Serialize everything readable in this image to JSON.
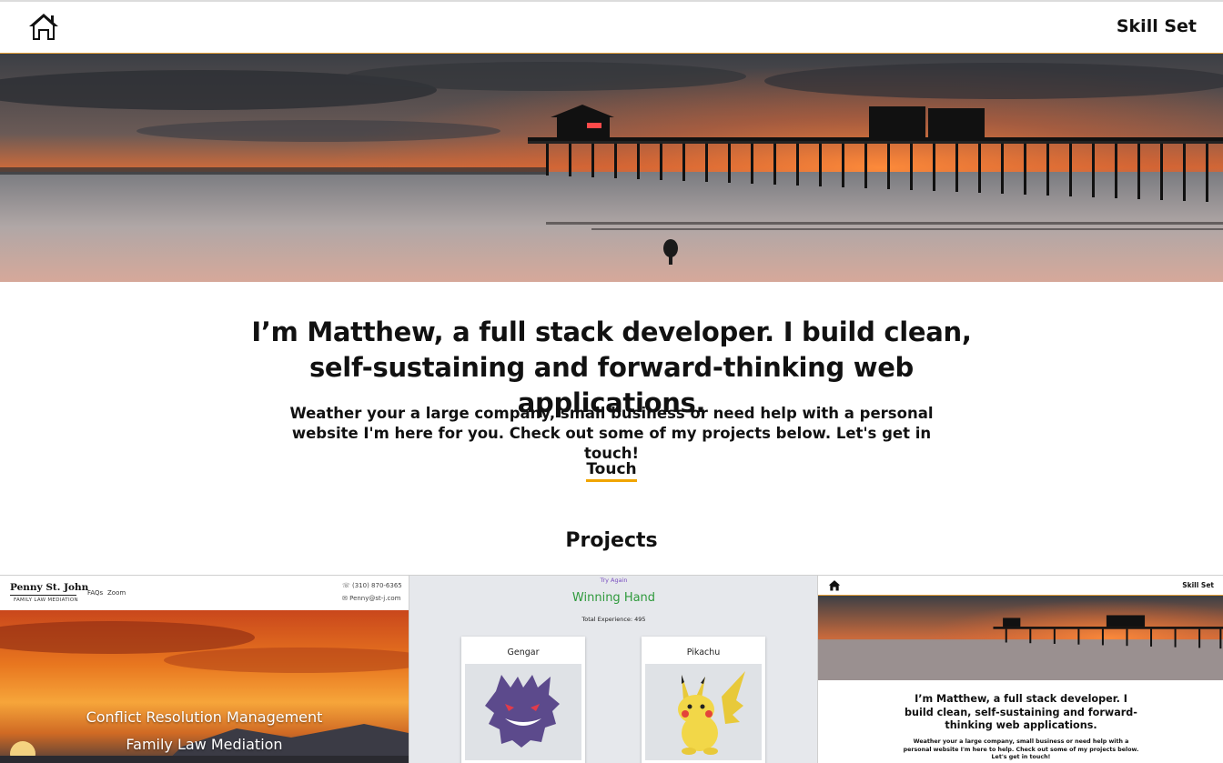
{
  "nav": {
    "home_icon": "home-icon",
    "right_link": "Skill Set"
  },
  "hero": {
    "image_subject": "beach-pier-sunset"
  },
  "intro": {
    "headline": "I’m Matthew, a full stack developer. I build clean, self-sustaining and forward-thinking web applications.",
    "subtext": "Weather your a large company, small business or need help with a personal website I'm here for you. Check out some of my projects below. Let's get in touch!",
    "cta_label": "Touch"
  },
  "projects": {
    "title": "Projects",
    "items": [
      {
        "header_name": "Penny St. John",
        "header_sub": "FAMILY LAW MEDIATION",
        "nav_links": [
          "FAQs",
          "Zoom"
        ],
        "phone": "(310) 870-6365",
        "email": "Penny@st-j.com",
        "line1": "Conflict Resolution Management",
        "line2": "Family Law Mediation"
      },
      {
        "try_again": "Try Again",
        "title": "Winning Hand",
        "experience": "Total Experience: 495",
        "cards": [
          "Gengar",
          "Pikachu"
        ]
      },
      {
        "home_icon": "home-icon",
        "right_link": "Skill Set",
        "headline": "I’m Matthew, a full stack developer. I build clean, self-sustaining and forward-thinking web applications.",
        "subtext": "Weather your a large company, small business or need help with a personal website I'm here to help. Check out some of my projects below. Let's get in touch!"
      }
    ]
  },
  "colors": {
    "accent_underline": "#f0a500",
    "win_green": "#2f9a3c",
    "link_purple": "#7a4fc1"
  }
}
